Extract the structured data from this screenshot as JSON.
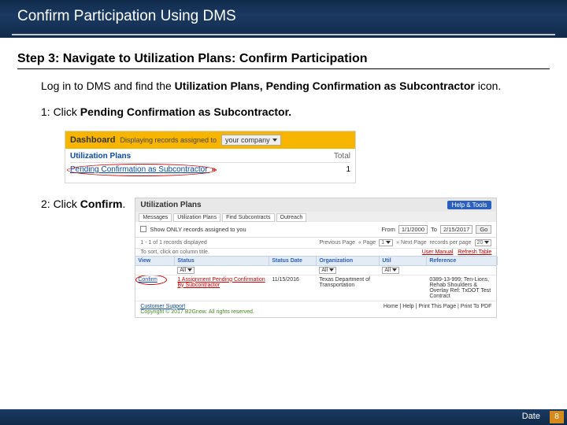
{
  "header": {
    "title": "Confirm Participation Using DMS"
  },
  "step": {
    "title": "Step 3: Navigate to Utilization Plans: Confirm Participation"
  },
  "intro": {
    "pre": "Log in to DMS and find the ",
    "bold": "Utilization Plans, Pending Confirmation as Subcontractor",
    "post": " icon."
  },
  "step1": {
    "pre": "1: Click ",
    "bold": "Pending Confirmation as Subcontractor."
  },
  "dashboard": {
    "title": "Dashboard",
    "subtitle": "Displaying records assigned to",
    "scope": "your company",
    "section": "Utilization Plans",
    "totalLabel": "Total",
    "pending": "Pending Confirmation as Subcontractor",
    "arrow": "»",
    "count": "1"
  },
  "step2": {
    "pre": "2: Click ",
    "bold": "Confirm",
    "post": "."
  },
  "panel": {
    "title": "Utilization Plans",
    "help": "Help & Tools",
    "tabs": [
      "Messages",
      "Utilization Plans",
      "Find Subcontracts",
      "Outreach"
    ],
    "filterLabel": "Show ONLY records assigned to you",
    "fromLabel": "From",
    "fromVal": "1/1/2000",
    "toLabel": "To",
    "toVal": "2/15/2017",
    "go": "Go",
    "pagerLeft": "1 - 1 of 1 records displayed",
    "pagerPrev": "Previous Page",
    "pagerPg": "« Page",
    "pagerPgVal": "1",
    "pagerNext": "» Next Page",
    "perPageLabel": "records per page",
    "perPage": "20",
    "hintLeft": "To sort, click on column title.",
    "hintRight1": "User Manual",
    "hintRight2": "Refresh Table",
    "cols": [
      "View",
      "Status",
      "Status Date",
      "Organization",
      "Util",
      "Reference"
    ],
    "allOpt": "All",
    "row": {
      "view": "Confirm",
      "status": "1 Assignment Pending Confirmation By Subcontractor",
      "date": "11/15/2016",
      "org": "Texas Department of Transportation",
      "util": "",
      "ref": "0389-13-999; Ten-Lions, Rehab Shoulders & Overlay Ref: TxDOT Test Contract"
    },
    "cs": "Customer Support",
    "copyright": "Copyright © 2017 B2Gnow. All rights reserved.",
    "links": "Home | Help | Print This Page | Print To PDF"
  },
  "footer": {
    "date": "Date",
    "page": "8"
  }
}
